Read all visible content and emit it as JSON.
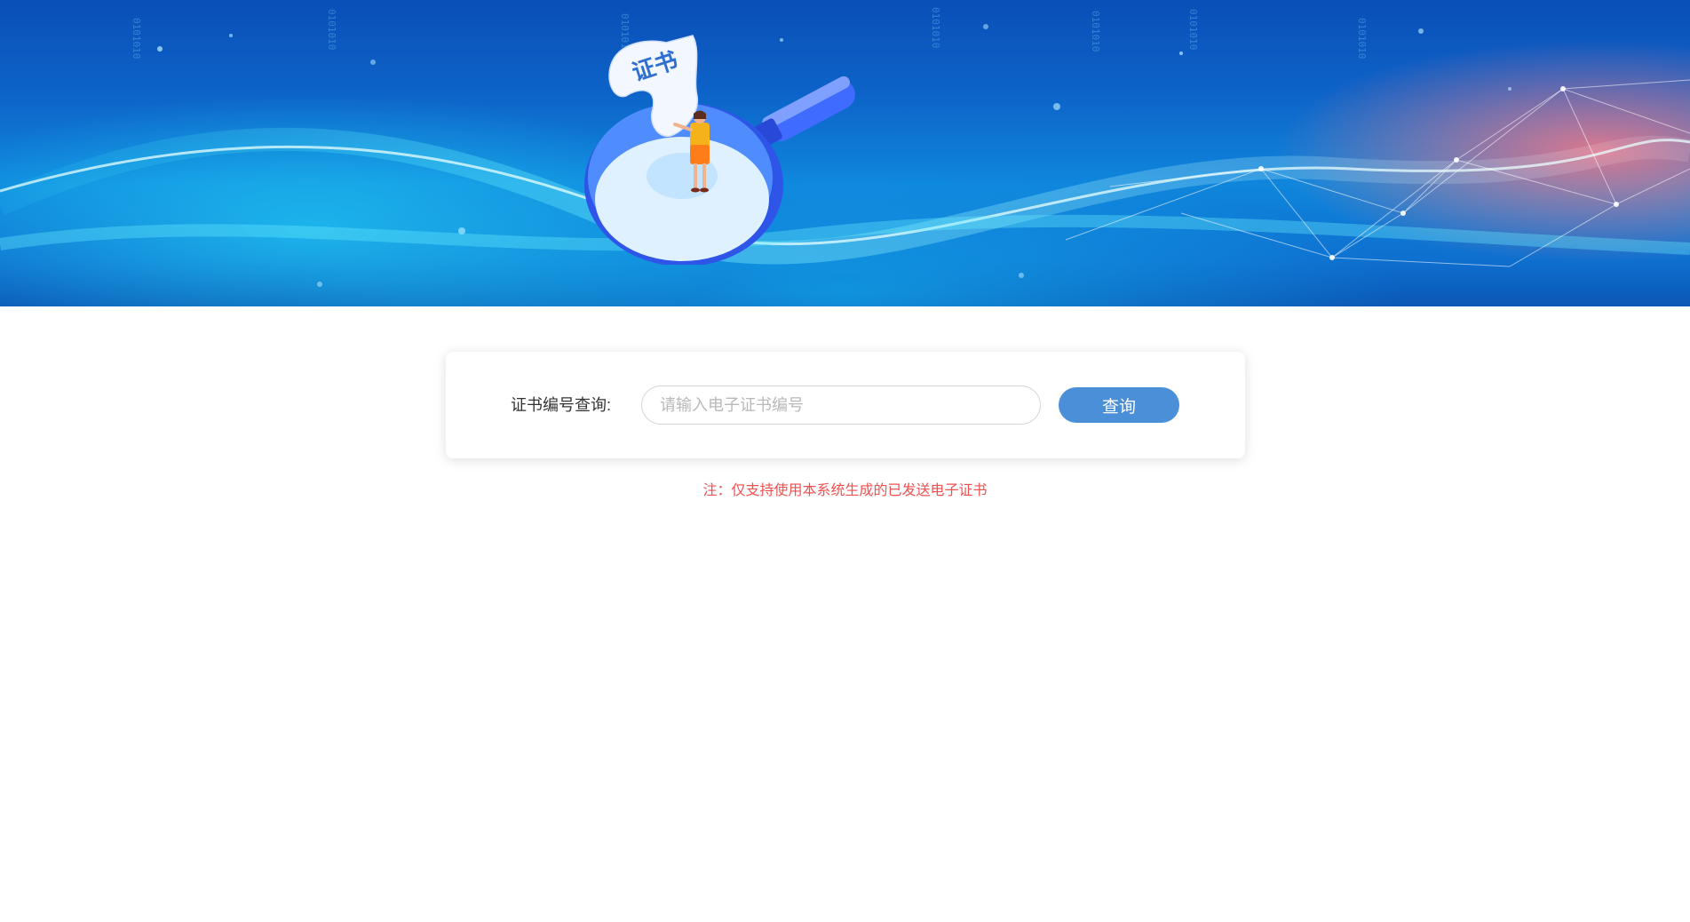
{
  "banner": {
    "scroll_text": "证书",
    "binary_text": "0101010"
  },
  "search": {
    "label": "证书编号查询:",
    "placeholder": "请输入电子证书编号",
    "value": "",
    "button_label": "查询"
  },
  "note": "注：仅支持使用本系统生成的已发送电子证书",
  "colors": {
    "accent": "#4a8fd8",
    "note": "#f0504f",
    "banner_blue": "#0d63c8"
  }
}
